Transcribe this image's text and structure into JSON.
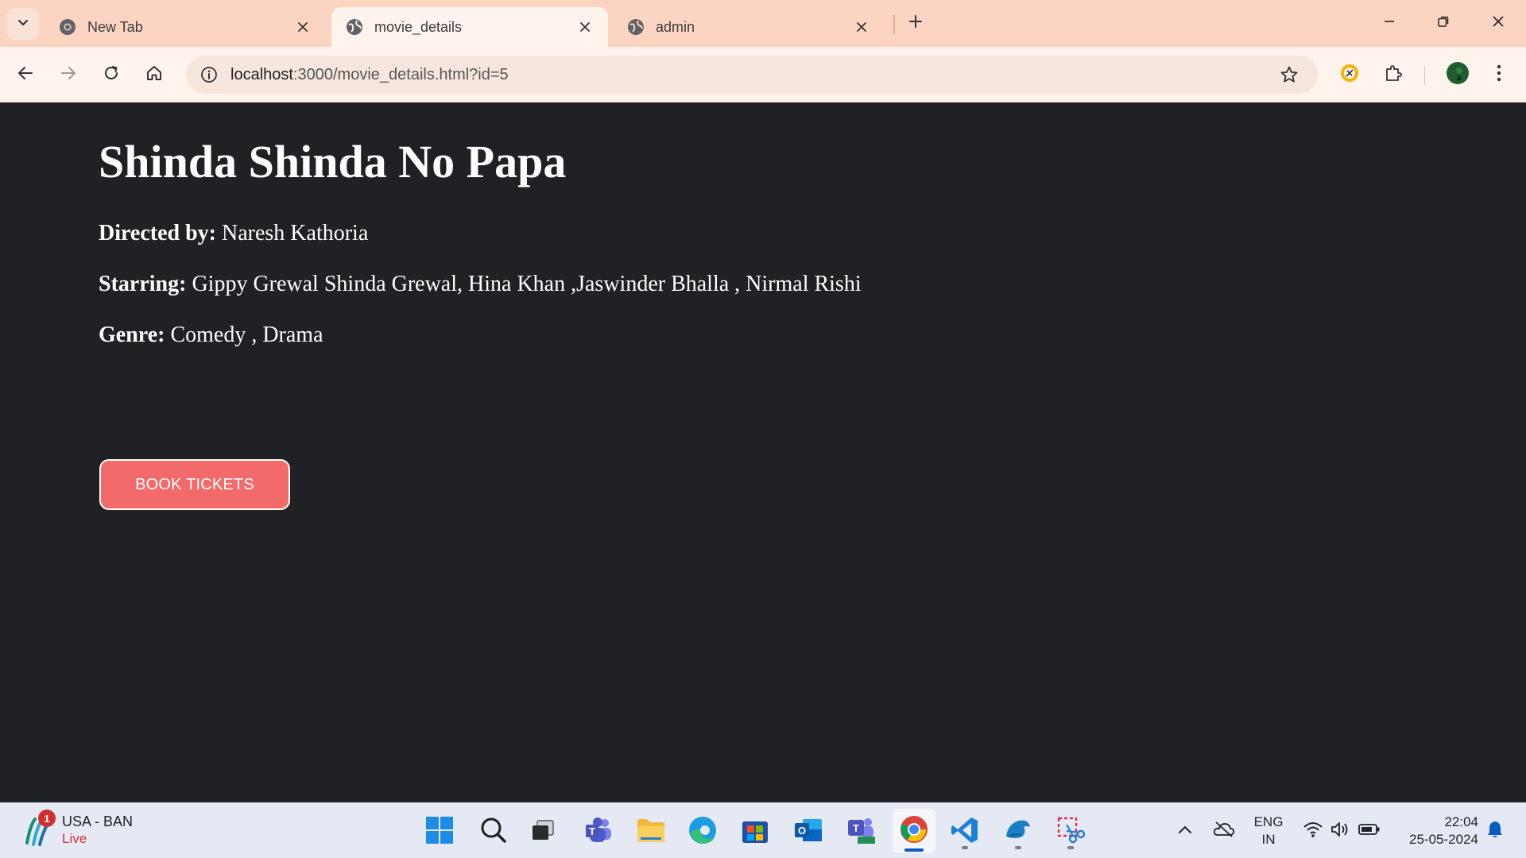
{
  "browser": {
    "tabs": [
      {
        "title": "New Tab",
        "active": false
      },
      {
        "title": "movie_details",
        "active": true
      },
      {
        "title": "admin",
        "active": false
      }
    ],
    "url_host": "localhost",
    "url_path": ":3000/movie_details.html?id=5"
  },
  "movie": {
    "title": "Shinda Shinda No Papa",
    "director_label": "Directed by:",
    "director": "Naresh Kathoria",
    "starring_label": "Starring:",
    "starring": "Gippy Grewal Shinda Grewal, Hina Khan ,Jaswinder Bhalla , Nirmal Rishi",
    "genre_label": "Genre:",
    "genre": "Comedy , Drama",
    "book_button": "BOOK TICKETS"
  },
  "taskbar": {
    "widget_title": "USA - BAN",
    "widget_status": "Live",
    "widget_badge": "1",
    "language_line1": "ENG",
    "language_line2": "IN",
    "time": "22:04",
    "date": "25-05-2024"
  },
  "colors": {
    "tab_strip": "#fcd4c2",
    "toolbar": "#fff3ee",
    "page_bg": "#202124",
    "button_bg": "#f26a6a",
    "taskbar_bg": "#e4e9f3"
  }
}
